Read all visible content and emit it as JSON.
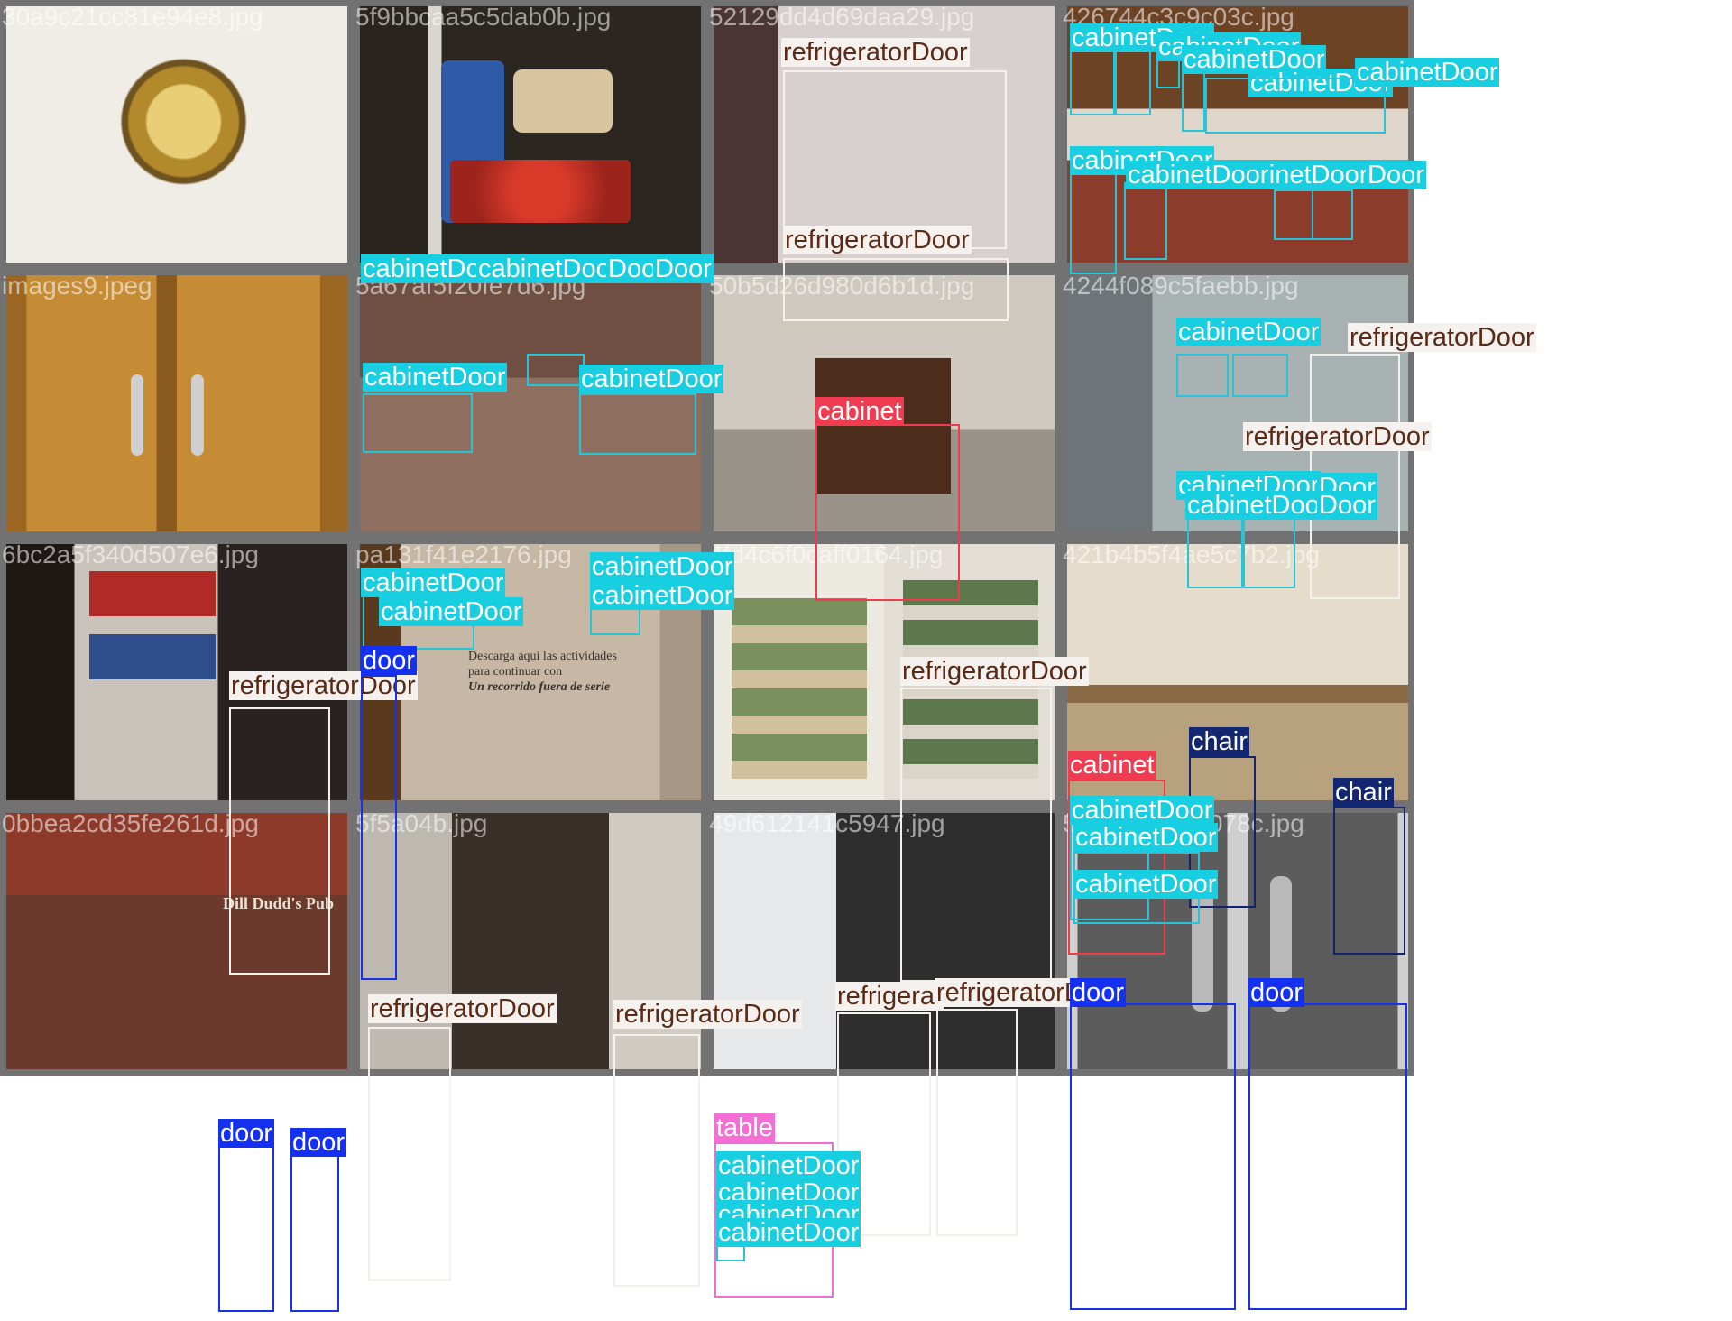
{
  "class_colors": {
    "cabinetDoor": {
      "box": "#27c3d8",
      "bg": "#17cfe0",
      "fg": "#ffffff"
    },
    "refrigeratorDoor": {
      "box": "#f4f1ed",
      "bg": "#f5f1ee",
      "fg": "#5a2a16"
    },
    "cabinet": {
      "box": "#ef3c4c",
      "bg": "#f03c50",
      "fg": "#ffffff"
    },
    "door": {
      "box": "#1631e8",
      "bg": "#1430f0",
      "fg": "#ffffff"
    },
    "chair": {
      "box": "#13246e",
      "bg": "#132670",
      "fg": "#ffffff"
    },
    "table": {
      "box": "#f06ed2",
      "bg": "#f46ed6",
      "fg": "#ffffff"
    }
  },
  "tiles": [
    {
      "filename": "30a9c21cc81e94e8.jpg",
      "scene": "lock-closeup",
      "palette": [
        "#d6c9a3",
        "#8a6a22",
        "#f2eee4"
      ],
      "detections": []
    },
    {
      "filename": "5f9bbcaa5c5dab0b.jpg",
      "scene": "fridge-shelf",
      "palette": [
        "#2b2620",
        "#c53a2a",
        "#dcd7cc"
      ],
      "detections": [
        {
          "label": "cabinetDoor"
        },
        {
          "label": "cabinetDoor"
        },
        {
          "label": "Door"
        },
        {
          "label": "Door"
        }
      ]
    },
    {
      "filename": "52129dd4d69daa29.jpg",
      "scene": "fridge-front",
      "palette": [
        "#5a4040",
        "#cfc7c6",
        "#e6e0de"
      ],
      "detections": [
        {
          "label": "refrigeratorDoor"
        },
        {
          "label": "refrigeratorDoor"
        }
      ]
    },
    {
      "filename": "426744c3c9c03c.jpg",
      "scene": "kitchen",
      "palette": [
        "#6d4326",
        "#e9e2da",
        "#8a3a2a"
      ],
      "detections": [
        {
          "label": "cabinetDoor"
        },
        {
          "label": "cabinetDoor"
        },
        {
          "label": "cabinetDoor"
        },
        {
          "label": "cabinetDoor"
        },
        {
          "label": "cabinetDoor"
        },
        {
          "label": "cabinetDoor"
        },
        {
          "label": "cabinetDoor"
        },
        {
          "label": "Door"
        },
        {
          "label": "cabinetDoor"
        }
      ]
    },
    {
      "filename": "images9.jpeg",
      "scene": "wood-cabinet",
      "palette": [
        "#b8802e",
        "#8f5d1d",
        "#d39a45"
      ],
      "detections": []
    },
    {
      "filename": "5a67af5f20fe7d6.jpg",
      "scene": "empty-kitchen",
      "palette": [
        "#8a6a5c",
        "#6b4f43",
        "#a48473"
      ],
      "detections": [
        {
          "label": "cabinetDoor"
        },
        {
          "label": "cabinetDoor"
        },
        {
          "label": "cabinetDoor"
        },
        {
          "label": "cabinetDoor"
        },
        {
          "label": "cabinetDoor"
        },
        {
          "label": "cabinetDoor"
        }
      ]
    },
    {
      "filename": "50b5d26d980d6b1d.jpg",
      "scene": "studio-cabinet",
      "palette": [
        "#c8c0b6",
        "#9a9288",
        "#4a2a18"
      ],
      "detections": [
        {
          "label": "cabinet"
        }
      ]
    },
    {
      "filename": "4244f089c5faebb.jpg",
      "scene": "blurry-kitchen",
      "palette": [
        "#8c9699",
        "#b3bcbd",
        "#6d7578"
      ],
      "detections": [
        {
          "label": "cabinetDoor"
        },
        {
          "label": "refrigeratorDoor"
        },
        {
          "label": "refrigeratorDoor"
        },
        {
          "label": "cabinetDoor"
        },
        {
          "label": "Door"
        },
        {
          "label": "cabinetDoor"
        },
        {
          "label": "Door"
        }
      ]
    },
    {
      "filename": "6bc2a5f340d507e6.jpg",
      "scene": "mini-fridge",
      "palette": [
        "#2a2220",
        "#c9c3bb",
        "#b02a28"
      ],
      "detections": [
        {
          "label": "refrigeratorDoor"
        }
      ]
    },
    {
      "filename": "pa131f41e2176.jpg",
      "scene": "museum-wall",
      "palette": [
        "#c9b9a4",
        "#a08f7a",
        "#6a3e22"
      ],
      "wall_text": [
        "Descarga aqui las actividades",
        "para continuar con",
        "Un recorrido fuera de serie"
      ],
      "detections": [
        {
          "label": "door"
        }
      ]
    },
    {
      "filename": "4fd4c6f0caff0164.jpg",
      "scene": "open-fridge",
      "palette": [
        "#e8e6df",
        "#55743a",
        "#b2552f"
      ],
      "detections": [
        {
          "label": "refrigeratorDoor"
        }
      ]
    },
    {
      "filename": "421b4b5f4ae5c7b2.jpg",
      "scene": "room",
      "palette": [
        "#b6a07c",
        "#7a5a3a",
        "#e3d6bf"
      ],
      "detections": [
        {
          "label": "cabinet"
        },
        {
          "label": "chair"
        },
        {
          "label": "cabinetDoor"
        },
        {
          "label": "cabinetDoor"
        },
        {
          "label": "cabinetDoor"
        },
        {
          "label": "chair"
        }
      ]
    },
    {
      "filename": "0bbea2cd35fe261d.jpg",
      "scene": "storefront",
      "sign_text": "Dill Dudd's Pub",
      "palette": [
        "#8c3a2a",
        "#4a3a30",
        "#6a8a40"
      ],
      "detections": [
        {
          "label": "door"
        },
        {
          "label": "door"
        }
      ]
    },
    {
      "filename": "5f5a04b.jpg",
      "scene": "french-fridge",
      "palette": [
        "#d8d4cc",
        "#3a302a",
        "#a8a095"
      ],
      "detections": [
        {
          "label": "refrigeratorDoor"
        },
        {
          "label": "refrigeratorDoor"
        }
      ]
    },
    {
      "filename": "49d612141c5947.jpg",
      "scene": "glass-fridge",
      "palette": [
        "#3a3a3a",
        "#c8ccd0",
        "#e6e8ea"
      ],
      "detections": [
        {
          "label": "refrigerat"
        },
        {
          "label": "refrigeratorD"
        },
        {
          "label": "table"
        },
        {
          "label": "cabinetDoor"
        },
        {
          "label": "cabinetDoor"
        },
        {
          "label": "cabinetDoor"
        },
        {
          "label": "cabinetDoor"
        }
      ]
    },
    {
      "filename": "54f549c1e45078c.jpg",
      "scene": "glass-doors",
      "palette": [
        "#585858",
        "#a9a9a9",
        "#cfcfcf"
      ],
      "detections": [
        {
          "label": "door"
        },
        {
          "label": "door"
        }
      ]
    }
  ]
}
